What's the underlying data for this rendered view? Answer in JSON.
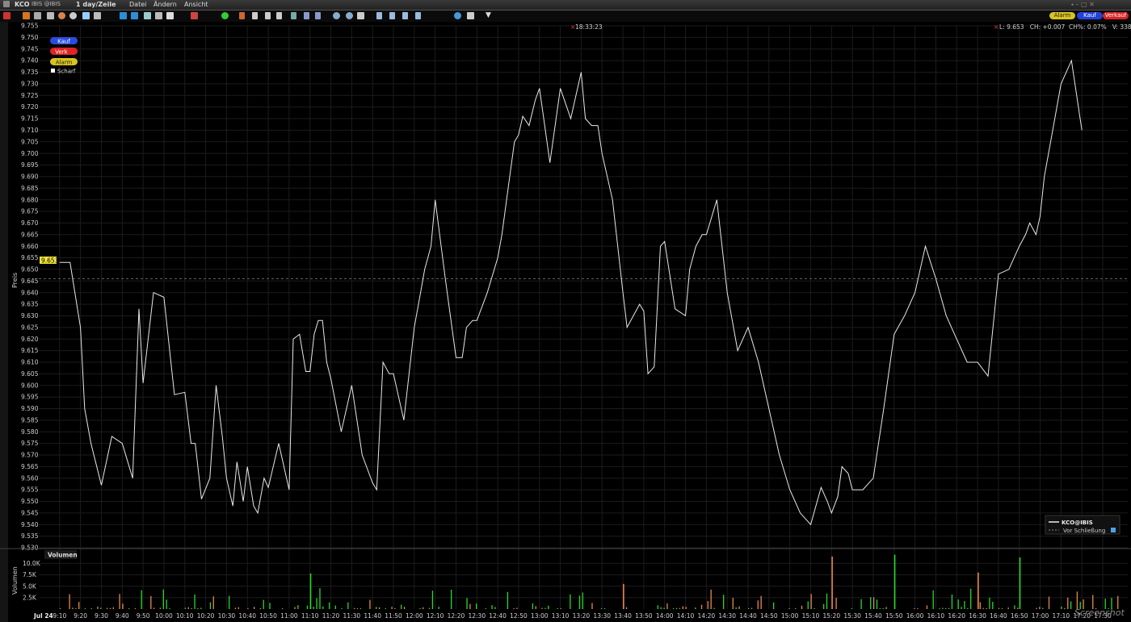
{
  "window": {
    "symbol": "KCO",
    "exchange_label": "IBIS @IBIS",
    "interval": "1 day/Zeile",
    "menu": [
      "Datei",
      "Ändern",
      "Ansicht"
    ]
  },
  "toolbar_right": {
    "alarm": "Alarm",
    "buy": "Kauf",
    "sell": "Verkauf"
  },
  "order_buttons": {
    "buy": "Kauf",
    "sell": "Verk",
    "alarm": "Alarm",
    "sharp": "Scharf"
  },
  "header": {
    "time": "18:33:23",
    "stats": "L: 9.653   CH: +0.007  CH%: 0.07%   V: 338K"
  },
  "legend": {
    "series": "KCO@IBIS",
    "prev_close": "Vor Schließung"
  },
  "labels": {
    "price_axis": "Preis",
    "volume_axis": "Volumen",
    "volume_panel": "Volumen",
    "watermark": "Screenshot"
  },
  "colors": {
    "line": "#e8e8e8",
    "up_volume": "#2bd62b",
    "down_volume": "#e8874a",
    "last_marker": "#f2e23a",
    "grid": "#222222"
  },
  "chart_data": [
    {
      "type": "line",
      "name": "price",
      "ylabel": "Preis",
      "ylim": [
        9.53,
        9.755
      ],
      "last_price": 9.653,
      "previous_close": 9.646,
      "y_ticks": [
        "9.755",
        "9.750",
        "9.745",
        "9.740",
        "9.735",
        "9.730",
        "9.725",
        "9.720",
        "9.715",
        "9.710",
        "9.705",
        "9.700",
        "9.695",
        "9.690",
        "9.685",
        "9.680",
        "9.675",
        "9.670",
        "9.665",
        "9.660",
        "9.655",
        "9.650",
        "9.645",
        "9.640",
        "9.635",
        "9.630",
        "9.625",
        "9.620",
        "9.615",
        "9.610",
        "9.605",
        "9.600",
        "9.595",
        "9.590",
        "9.585",
        "9.580",
        "9.575",
        "9.570",
        "9.565",
        "9.560",
        "9.555",
        "9.550",
        "9.545",
        "9.540",
        "9.535",
        "9.530"
      ],
      "x_ticks": [
        "Jul 24",
        "9:10",
        "9:20",
        "9:30",
        "9:40",
        "9:50",
        "10:00",
        "10:10",
        "10:20",
        "10:30",
        "10:40",
        "10:50",
        "11:00",
        "11:10",
        "11:20",
        "11:30",
        "11:40",
        "11:50",
        "12:00",
        "12:10",
        "12:20",
        "12:30",
        "12:40",
        "12:50",
        "13:00",
        "13:10",
        "13:20",
        "13:30",
        "13:40",
        "13:50",
        "14:00",
        "14:10",
        "14:20",
        "14:30",
        "14:40",
        "14:50",
        "15:00",
        "15:10",
        "15:20",
        "15:30",
        "15:40",
        "15:50",
        "16:00",
        "16:10",
        "16:20",
        "16:30",
        "16:40",
        "16:50",
        "17:00",
        "17:10",
        "17:20",
        "17:30"
      ],
      "x_minutes": [
        540,
        545,
        550,
        552,
        555,
        560,
        565,
        570,
        575,
        578,
        580,
        585,
        590,
        595,
        600,
        603,
        605,
        608,
        612,
        615,
        618,
        620,
        623,
        625,
        628,
        630,
        633,
        635,
        638,
        640,
        645,
        650,
        652,
        655,
        658,
        660,
        662,
        664,
        666,
        668,
        670,
        675,
        680,
        685,
        690,
        692,
        695,
        698,
        700,
        705,
        710,
        713,
        715,
        718,
        720,
        725,
        730,
        733,
        735,
        738,
        740,
        745,
        750,
        752,
        755,
        758,
        760,
        762,
        765,
        768,
        770,
        775,
        780,
        785,
        790,
        792,
        795,
        798,
        800,
        805,
        810,
        812,
        815,
        818,
        820,
        822,
        825,
        828,
        830,
        835,
        840,
        842,
        845,
        848,
        850,
        855,
        860,
        865,
        870,
        875,
        880,
        885,
        890,
        895,
        900,
        905,
        908,
        910,
        913,
        915,
        918,
        920,
        925,
        930,
        935,
        940,
        945,
        950,
        955,
        960,
        965,
        970,
        975,
        980,
        985,
        990,
        995,
        1000,
        1003,
        1005,
        1008,
        1010,
        1012,
        1015,
        1020,
        1025,
        1030
      ],
      "values": [
        9.653,
        9.653,
        9.625,
        9.59,
        9.575,
        9.557,
        9.578,
        9.575,
        9.56,
        9.633,
        9.601,
        9.64,
        9.638,
        9.596,
        9.597,
        9.575,
        9.575,
        9.551,
        9.56,
        9.6,
        9.578,
        9.56,
        9.548,
        9.567,
        9.55,
        9.565,
        9.548,
        9.545,
        9.56,
        9.556,
        9.575,
        9.555,
        9.62,
        9.622,
        9.606,
        9.606,
        9.622,
        9.628,
        9.628,
        9.61,
        9.603,
        9.58,
        9.6,
        9.57,
        9.558,
        9.555,
        9.61,
        9.605,
        9.605,
        9.585,
        9.625,
        9.64,
        9.65,
        9.66,
        9.68,
        9.645,
        9.612,
        9.612,
        9.625,
        9.628,
        9.628,
        9.64,
        9.655,
        9.665,
        9.685,
        9.705,
        9.708,
        9.716,
        9.712,
        9.723,
        9.728,
        9.696,
        9.728,
        9.715,
        9.735,
        9.715,
        9.712,
        9.712,
        9.7,
        9.68,
        9.64,
        9.625,
        9.63,
        9.635,
        9.632,
        9.605,
        9.608,
        9.66,
        9.662,
        9.633,
        9.63,
        9.65,
        9.66,
        9.665,
        9.665,
        9.68,
        9.64,
        9.615,
        9.625,
        9.61,
        9.59,
        9.57,
        9.555,
        9.545,
        9.54,
        9.556,
        9.55,
        9.545,
        9.552,
        9.565,
        9.562,
        9.555,
        9.555,
        9.56,
        9.59,
        9.622,
        9.63,
        9.64,
        9.66,
        9.646,
        9.63,
        9.62,
        9.61,
        9.61,
        9.604,
        9.648,
        9.65,
        9.66,
        9.665,
        9.67,
        9.665,
        9.673,
        9.69,
        9.705,
        9.73,
        9.74,
        9.71
      ]
    },
    {
      "type": "bar",
      "name": "volume",
      "ylabel": "Volumen",
      "ylim": [
        0,
        12000
      ],
      "y_ticks": [
        "10.0K",
        "7.5K",
        "5.0K",
        "2.5K"
      ],
      "peaks": [
        {
          "time": "11:00",
          "value": 7800,
          "color": "up"
        },
        {
          "time": "15:10",
          "value": 11500,
          "color": "down"
        },
        {
          "time": "15:40",
          "value": 11900,
          "color": "up"
        },
        {
          "time": "16:40",
          "value": 11300,
          "color": "up"
        },
        {
          "time": "16:20",
          "value": 8000,
          "color": "down"
        },
        {
          "time": "13:30",
          "value": 5500,
          "color": "down"
        }
      ]
    }
  ]
}
